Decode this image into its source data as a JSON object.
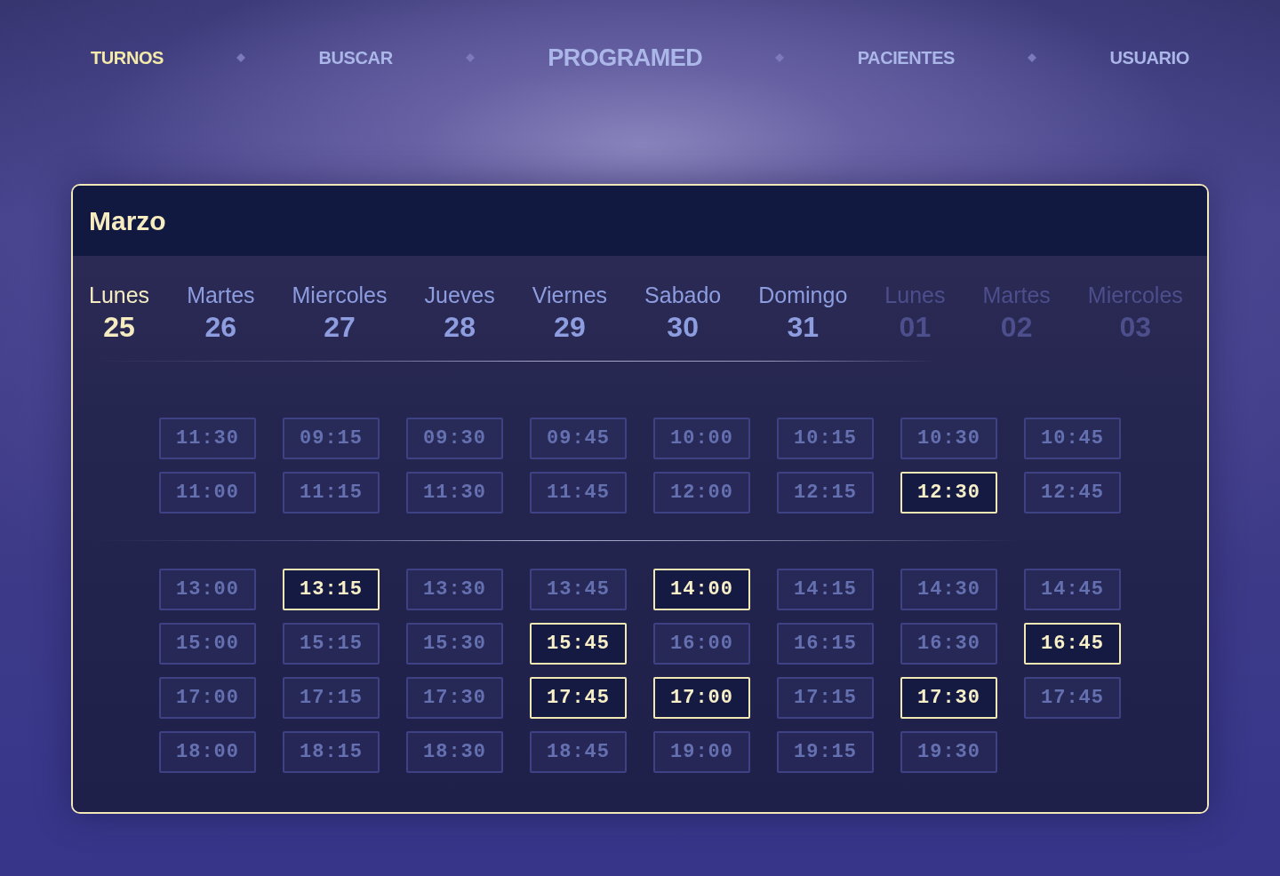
{
  "nav": {
    "items": [
      {
        "label": "TURNOS",
        "kind": "link",
        "selected": true
      },
      {
        "label": "BUSCAR",
        "kind": "link",
        "selected": false
      },
      {
        "label": "PROGRAMED",
        "kind": "brand",
        "selected": false
      },
      {
        "label": "PACIENTES",
        "kind": "link",
        "selected": false
      },
      {
        "label": "USUARIO",
        "kind": "link",
        "selected": false
      }
    ]
  },
  "calendar": {
    "month": "Marzo",
    "days": [
      {
        "name": "Lunes",
        "date": "25",
        "selected": true,
        "disabled": false
      },
      {
        "name": "Martes",
        "date": "26",
        "selected": false,
        "disabled": false
      },
      {
        "name": "Miercoles",
        "date": "27",
        "selected": false,
        "disabled": false
      },
      {
        "name": "Jueves",
        "date": "28",
        "selected": false,
        "disabled": false
      },
      {
        "name": "Viernes",
        "date": "29",
        "selected": false,
        "disabled": false
      },
      {
        "name": "Sabado",
        "date": "30",
        "selected": false,
        "disabled": false
      },
      {
        "name": "Domingo",
        "date": "31",
        "selected": false,
        "disabled": false
      },
      {
        "name": "Lunes",
        "date": "01",
        "selected": false,
        "disabled": true
      },
      {
        "name": "Martes",
        "date": "02",
        "selected": false,
        "disabled": true
      },
      {
        "name": "Miercoles",
        "date": "03",
        "selected": false,
        "disabled": true
      }
    ],
    "slot_groups": [
      {
        "slots": [
          {
            "time": "11:30",
            "selected": false
          },
          {
            "time": "09:15",
            "selected": false
          },
          {
            "time": "09:30",
            "selected": false
          },
          {
            "time": "09:45",
            "selected": false
          },
          {
            "time": "10:00",
            "selected": false
          },
          {
            "time": "10:15",
            "selected": false
          },
          {
            "time": "10:30",
            "selected": false
          },
          {
            "time": "10:45",
            "selected": false
          },
          {
            "time": "11:00",
            "selected": false
          },
          {
            "time": "11:15",
            "selected": false
          },
          {
            "time": "11:30",
            "selected": false
          },
          {
            "time": "11:45",
            "selected": false
          },
          {
            "time": "12:00",
            "selected": false
          },
          {
            "time": "12:15",
            "selected": false
          },
          {
            "time": "12:30",
            "selected": true
          },
          {
            "time": "12:45",
            "selected": false
          }
        ]
      },
      {
        "slots": [
          {
            "time": "13:00",
            "selected": false
          },
          {
            "time": "13:15",
            "selected": true
          },
          {
            "time": "13:30",
            "selected": false
          },
          {
            "time": "13:45",
            "selected": false
          },
          {
            "time": "14:00",
            "selected": true
          },
          {
            "time": "14:15",
            "selected": false
          },
          {
            "time": "14:30",
            "selected": false
          },
          {
            "time": "14:45",
            "selected": false
          },
          {
            "time": "15:00",
            "selected": false
          },
          {
            "time": "15:15",
            "selected": false
          },
          {
            "time": "15:30",
            "selected": false
          },
          {
            "time": "15:45",
            "selected": true
          },
          {
            "time": "16:00",
            "selected": false
          },
          {
            "time": "16:15",
            "selected": false
          },
          {
            "time": "16:30",
            "selected": false
          },
          {
            "time": "16:45",
            "selected": true
          },
          {
            "time": "17:00",
            "selected": false
          },
          {
            "time": "17:15",
            "selected": false
          },
          {
            "time": "17:30",
            "selected": false
          },
          {
            "time": "17:45",
            "selected": true
          },
          {
            "time": "17:00",
            "selected": true
          },
          {
            "time": "17:15",
            "selected": false
          },
          {
            "time": "17:30",
            "selected": true
          },
          {
            "time": "17:45",
            "selected": false
          },
          {
            "time": "18:00",
            "selected": false
          },
          {
            "time": "18:15",
            "selected": false
          },
          {
            "time": "18:30",
            "selected": false
          },
          {
            "time": "18:45",
            "selected": false
          },
          {
            "time": "19:00",
            "selected": false
          },
          {
            "time": "19:15",
            "selected": false
          },
          {
            "time": "19:30",
            "selected": false
          }
        ]
      }
    ]
  }
}
